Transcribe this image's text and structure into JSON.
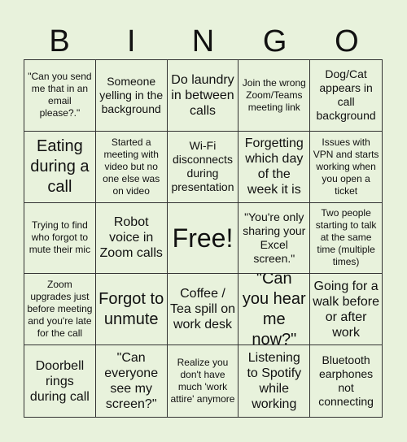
{
  "header": {
    "letters": [
      "B",
      "I",
      "N",
      "G",
      "O"
    ]
  },
  "colors": {
    "background": "#e8f2dc",
    "grid_line": "#333333",
    "text": "#111111"
  },
  "cells": [
    {
      "text": "\"Can you send me that in an email please?.\"",
      "size": "sm"
    },
    {
      "text": "Someone yelling in the background",
      "size": "md"
    },
    {
      "text": "Do laundry in between calls",
      "size": "lg"
    },
    {
      "text": "Join the wrong Zoom/Teams meeting link",
      "size": "sm"
    },
    {
      "text": "Dog/Cat appears in call background",
      "size": "md"
    },
    {
      "text": "Eating during a call",
      "size": "xl"
    },
    {
      "text": "Started a meeting with video but no one else was on video",
      "size": "sm"
    },
    {
      "text": "Wi-Fi disconnects during presentation",
      "size": "md"
    },
    {
      "text": "Forgetting which day of the week it is",
      "size": "lg"
    },
    {
      "text": "Issues with VPN and starts working when you open a ticket",
      "size": "sm"
    },
    {
      "text": "Trying to find who forgot to mute their mic",
      "size": "sm"
    },
    {
      "text": "Robot voice in Zoom calls",
      "size": "lg"
    },
    {
      "text": "Free!",
      "size": "free"
    },
    {
      "text": "\"You're only sharing your Excel screen.\"",
      "size": "md"
    },
    {
      "text": "Two people starting to talk at the same time (multiple times)",
      "size": "sm"
    },
    {
      "text": "Zoom upgrades just before meeting and you're late for the call",
      "size": "sm"
    },
    {
      "text": "Forgot to unmute",
      "size": "xl"
    },
    {
      "text": "Coffee / Tea spill on work desk",
      "size": "lg"
    },
    {
      "text": "\"Can you hear me now?\"",
      "size": "xl"
    },
    {
      "text": "Going for a walk before or after work",
      "size": "lg"
    },
    {
      "text": "Doorbell rings during call",
      "size": "lg"
    },
    {
      "text": "\"Can everyone see my screen?\"",
      "size": "lg"
    },
    {
      "text": "Realize you don't have much 'work attire' anymore",
      "size": "sm"
    },
    {
      "text": "Listening to Spotify while working",
      "size": "lg"
    },
    {
      "text": "Bluetooth earphones not connecting",
      "size": "md"
    }
  ]
}
